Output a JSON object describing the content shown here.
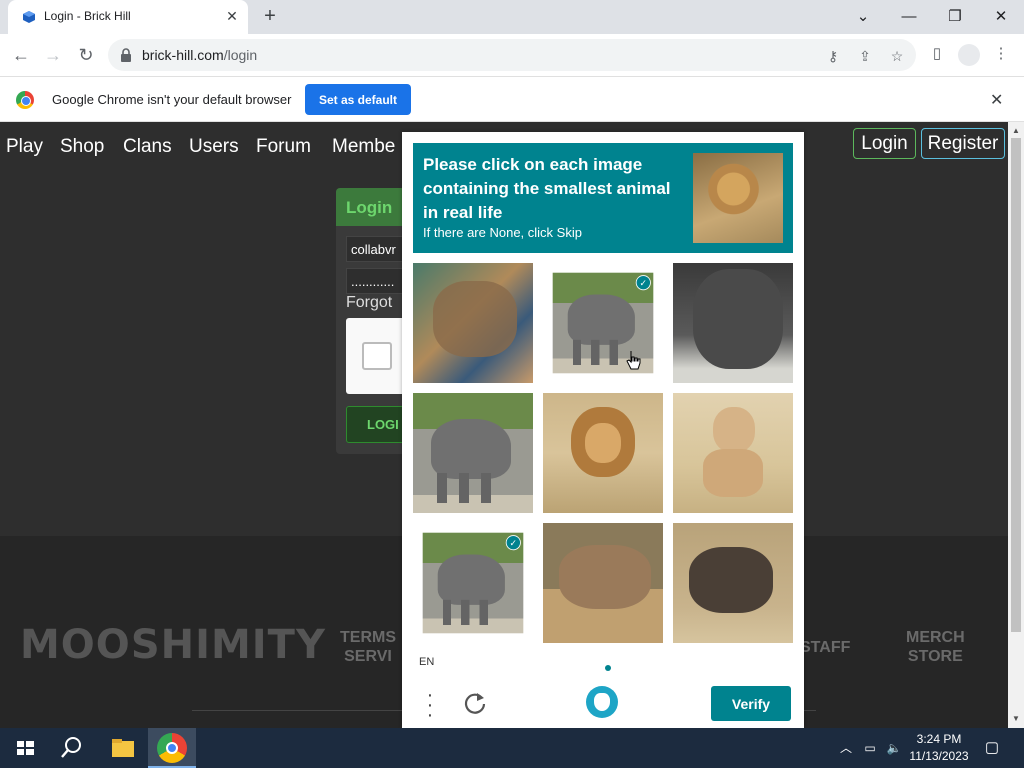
{
  "browser": {
    "tab_title": "Login - Brick Hill",
    "url_host": "brick-hill.com",
    "url_path": "/login"
  },
  "infobar": {
    "message": "Google Chrome isn't your default browser",
    "set_default_label": "Set as default"
  },
  "site_nav": {
    "links": [
      "Play",
      "Shop",
      "Clans",
      "Users",
      "Forum",
      "Membe"
    ],
    "login_label": "Login",
    "register_label": "Register"
  },
  "login_form": {
    "title": "Login",
    "username_value": "collabvr",
    "password_value": "............",
    "forgot_label": "Forgot",
    "submit_label": "LOGI"
  },
  "footer": {
    "logo_text": "MOOSHIMITY",
    "links": [
      "TERMS\nSERVI",
      "STAFF",
      "MERCH\nSTORE"
    ]
  },
  "captcha": {
    "prompt": "Please click on each image containing the smallest animal in real life",
    "sub_prompt": "If there are None, click Skip",
    "language": "EN",
    "verify_label": "Verify",
    "tiles": [
      {
        "subject": "distorted elephant",
        "selected": false
      },
      {
        "subject": "elephant",
        "selected": true
      },
      {
        "subject": "elephant close-up",
        "selected": false
      },
      {
        "subject": "elephant",
        "selected": false
      },
      {
        "subject": "lion",
        "selected": false
      },
      {
        "subject": "lioness",
        "selected": false
      },
      {
        "subject": "elephant",
        "selected": true
      },
      {
        "subject": "elephant",
        "selected": false
      },
      {
        "subject": "elephant",
        "selected": false
      }
    ],
    "accent_color": "#00838f"
  },
  "taskbar": {
    "time": "3:24 PM",
    "date": "11/13/2023"
  }
}
